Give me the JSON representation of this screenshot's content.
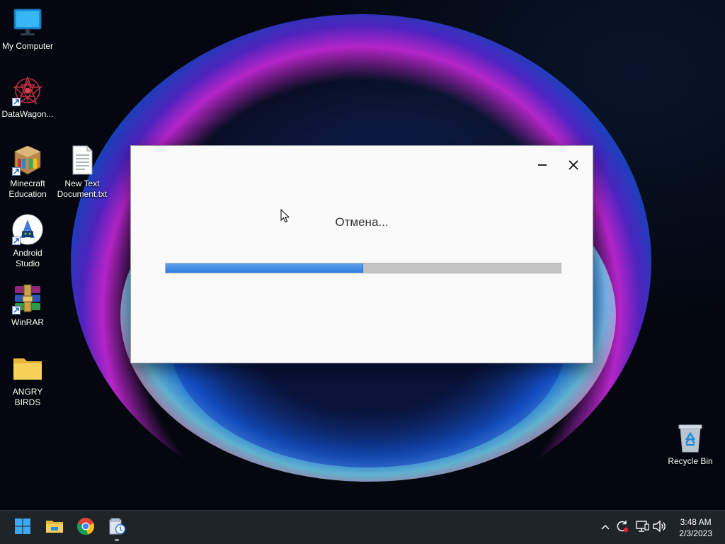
{
  "desktop": {
    "icons": [
      {
        "label": "My Computer"
      },
      {
        "label": "DataWagon..."
      },
      {
        "label": "Minecraft Education"
      },
      {
        "label": "New Text Document.txt"
      },
      {
        "label": "Android Studio"
      },
      {
        "label": "WinRAR"
      },
      {
        "label": "ANGRY BIRDS"
      },
      {
        "label": "Recycle Bin"
      }
    ]
  },
  "dialog": {
    "status_text": "Отмена...",
    "progress_percent": 50,
    "minimize_icon": "minimize-icon",
    "close_icon": "close-icon"
  },
  "taskbar": {
    "pinned": [
      {
        "icon": "windows-start-icon"
      },
      {
        "icon": "file-explorer-icon"
      },
      {
        "icon": "chrome-icon"
      },
      {
        "icon": "installer-icon",
        "active": true
      }
    ],
    "tray": [
      {
        "icon": "chevron-up-icon"
      },
      {
        "icon": "sync-icon"
      },
      {
        "icon": "network-icon"
      },
      {
        "icon": "volume-icon"
      }
    ],
    "clock": {
      "time": "3:48 AM",
      "date": "2/3/2023"
    }
  },
  "colors": {
    "accent": "#2f7ce0",
    "progress_track": "#c4c4c4",
    "taskbar_bg": "#1f2429",
    "dialog_bg": "#fafafa"
  }
}
